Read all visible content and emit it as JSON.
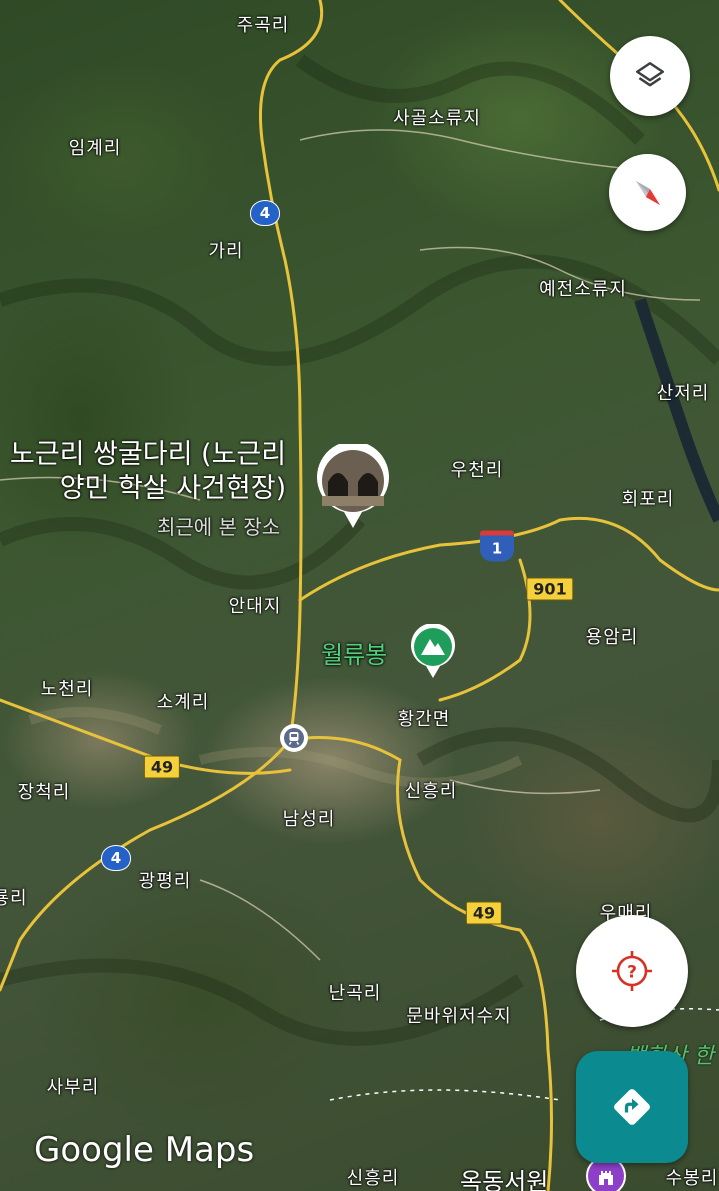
{
  "app_logo": "Google Maps",
  "buttons": {
    "layers": "layers-icon",
    "compass": "compass-icon",
    "my_location": "location-unknown-icon",
    "directions": "directions-icon"
  },
  "selected_place": {
    "title_line1": "노근리 쌍굴다리 (노근리",
    "title_line2": "양민 학살 사건현장)",
    "subtitle": "최근에 본 장소"
  },
  "peak": {
    "name": "월류봉"
  },
  "highlighted_place": {
    "name": "옥동서원"
  },
  "park_label": "백화산 한",
  "place_labels": [
    {
      "id": "jugok",
      "text": "주곡리"
    },
    {
      "id": "imgye",
      "text": "임계리"
    },
    {
      "id": "sagol",
      "text": "사골소류지"
    },
    {
      "id": "gari",
      "text": "가리"
    },
    {
      "id": "yejeon",
      "text": "예전소류지"
    },
    {
      "id": "sanjeo",
      "text": "산저리"
    },
    {
      "id": "ucheon",
      "text": "우천리"
    },
    {
      "id": "hoepo",
      "text": "회포리"
    },
    {
      "id": "andae",
      "text": "안대지"
    },
    {
      "id": "yongam",
      "text": "용암리"
    },
    {
      "id": "nocheon",
      "text": "노천리"
    },
    {
      "id": "sogye",
      "text": "소계리"
    },
    {
      "id": "hwanggan",
      "text": "황간면"
    },
    {
      "id": "jangcheok",
      "text": "장척리"
    },
    {
      "id": "sinheung1",
      "text": "신흥리"
    },
    {
      "id": "namseong",
      "text": "남성리"
    },
    {
      "id": "gwangpyeong",
      "text": "광평리"
    },
    {
      "id": "ryongri",
      "text": "룡리"
    },
    {
      "id": "umae",
      "text": "우매리"
    },
    {
      "id": "nangok",
      "text": "난곡리"
    },
    {
      "id": "munbawi",
      "text": "문바위저수지"
    },
    {
      "id": "sabu",
      "text": "사부리"
    },
    {
      "id": "sinheung2",
      "text": "신흥리"
    },
    {
      "id": "subong",
      "text": "수봉리"
    }
  ],
  "route_shields": [
    {
      "id": "r4a",
      "type": "national",
      "number": "4"
    },
    {
      "id": "r4b",
      "type": "national",
      "number": "4"
    },
    {
      "id": "r1",
      "type": "expressway",
      "number": "1"
    },
    {
      "id": "r901",
      "type": "local",
      "number": "901"
    },
    {
      "id": "r49a",
      "type": "local",
      "number": "49"
    },
    {
      "id": "r49b",
      "type": "local",
      "number": "49"
    }
  ],
  "colors": {
    "road_yellow": "#e8c23a",
    "directions_teal": "#0b8a8f",
    "peak_green": "#1e9e5a",
    "poi_purple": "#8e3fc9",
    "location_red": "#d93025"
  }
}
